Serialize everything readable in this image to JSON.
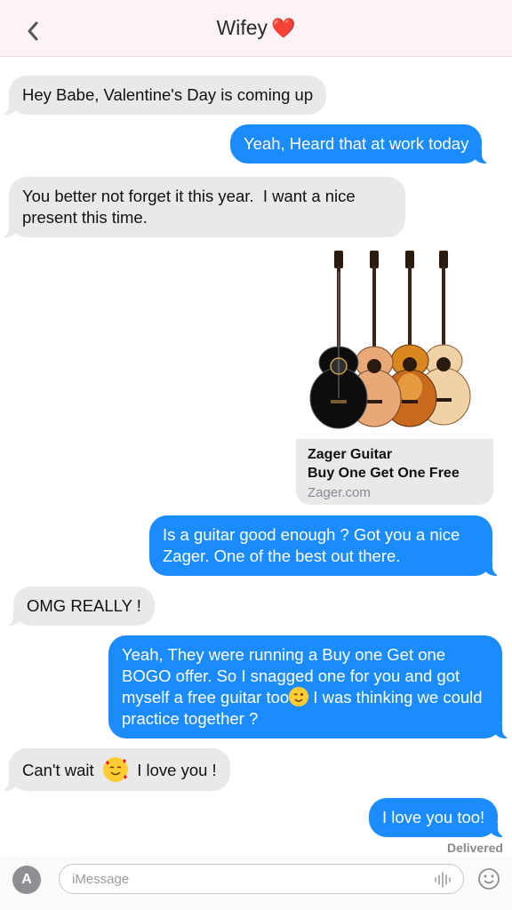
{
  "header": {
    "title": "Wifey",
    "title_emoji": "❤️",
    "back_icon": "chevron-left-icon"
  },
  "messages": [
    {
      "side": "in",
      "text": "Hey Babe, Valentine's Day is coming up"
    },
    {
      "side": "out",
      "text": "Yeah, Heard that at work today"
    },
    {
      "side": "in",
      "text": "You better not forget it this year.  I want a nice present this time."
    },
    {
      "side": "out",
      "text": "Is a guitar good enough ? Got you a nice Zager. One of the best out there."
    },
    {
      "side": "in",
      "text": "OMG REALLY !"
    },
    {
      "side": "out",
      "text_before_emoji": "Yeah, They were running a Buy one Get one BOGO offer. So I snagged one for you and got myself a free guitar too",
      "emoji": "winking-face-icon",
      "text_after_emoji": " I was thinking we could practice together ?"
    },
    {
      "side": "in",
      "text_before_emoji": "Can't wait  ",
      "emoji": "smiling-face-with-hearts-icon",
      "text_after_emoji": "  I love you !"
    },
    {
      "side": "out",
      "text": "I love you too!"
    }
  ],
  "link_preview": {
    "title_line1": "Zager Guitar",
    "title_line2": "Buy One Get One Free",
    "domain": "Zager.com",
    "image": "acoustic-guitars-image",
    "guitar_colors": [
      "#0d0d0d",
      "#e9a878",
      "#c86a1e",
      "#f1d2a6"
    ]
  },
  "status": {
    "delivered": "Delivered"
  },
  "composer": {
    "placeholder": "iMessage",
    "apps_icon": "app-store-icon",
    "mic_icon": "audio-waveform-icon",
    "emoji_icon": "emoji-icon"
  },
  "colors": {
    "outgoing": "#1a8cff",
    "incoming": "#e9e9eb",
    "header_bg": "#fbf3f5"
  }
}
